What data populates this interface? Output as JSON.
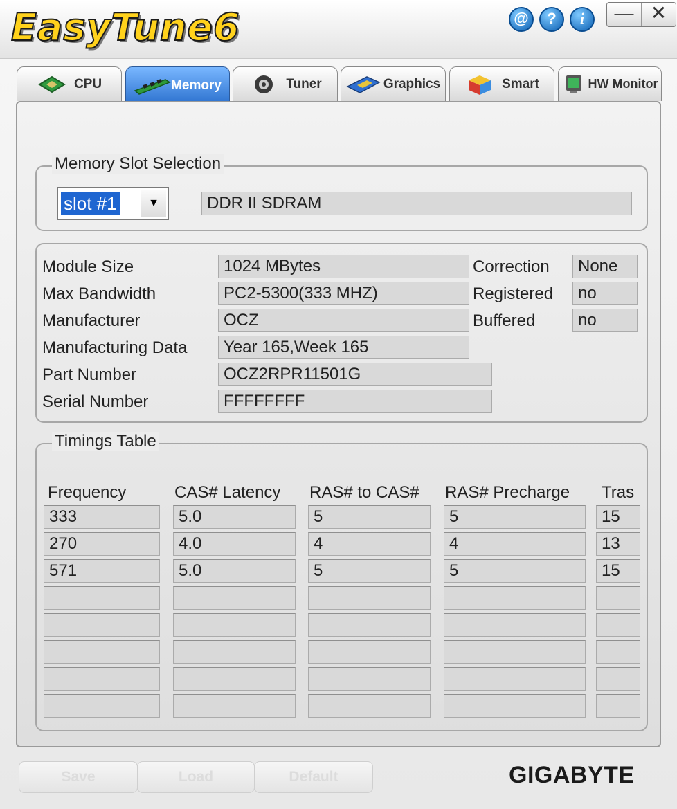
{
  "app": {
    "logo_text": "EasyTune6"
  },
  "header_icons": [
    {
      "icon": "at-icon",
      "glyph": "@"
    },
    {
      "icon": "help-icon",
      "glyph": "?"
    },
    {
      "icon": "info-icon",
      "glyph": "i"
    }
  ],
  "window_buttons": {
    "minimize": "—",
    "close": "✕"
  },
  "tabs": [
    {
      "label": "CPU",
      "icon": "cpu-chip-icon"
    },
    {
      "label": "Memory",
      "icon": "memory-stick-icon"
    },
    {
      "label": "Tuner",
      "icon": "tuner-dial-icon"
    },
    {
      "label": "Graphics",
      "icon": "graphics-card-icon"
    },
    {
      "label": "Smart",
      "icon": "smart-cube-icon"
    },
    {
      "label": "HW Monitor",
      "icon": "hw-monitor-icon"
    }
  ],
  "active_tab": "Memory",
  "slot_selection": {
    "legend": "Memory Slot Selection",
    "selected": "slot #1",
    "memory_type": "DDR II SDRAM"
  },
  "module_info": {
    "labels": {
      "module_size": "Module Size",
      "max_bandwidth": "Max Bandwidth",
      "manufacturer": "Manufacturer",
      "manufacturing_data": "Manufacturing Data",
      "part_number": "Part Number",
      "serial_number": "Serial Number",
      "correction": "Correction",
      "registered": "Registered",
      "buffered": "Buffered"
    },
    "values": {
      "module_size": "1024 MBytes",
      "max_bandwidth": "PC2-5300(333 MHZ)",
      "manufacturer": "OCZ",
      "manufacturing_data": "Year 165,Week 165",
      "part_number": "OCZ2RPR11501G",
      "serial_number": "FFFFFFFF",
      "correction": "None",
      "registered": "no",
      "buffered": "no"
    }
  },
  "timings": {
    "legend": "Timings Table",
    "headers": [
      "Frequency",
      "CAS# Latency",
      "RAS# to CAS#",
      "RAS# Precharge",
      "Tras"
    ],
    "rows": [
      [
        "333",
        "5.0",
        "5",
        "5",
        "15"
      ],
      [
        "270",
        "4.0",
        "4",
        "4",
        "13"
      ],
      [
        "571",
        "5.0",
        "5",
        "5",
        "15"
      ],
      [
        "",
        "",
        "",
        "",
        ""
      ],
      [
        "",
        "",
        "",
        "",
        ""
      ],
      [
        "",
        "",
        "",
        "",
        ""
      ],
      [
        "",
        "",
        "",
        "",
        ""
      ],
      [
        "",
        "",
        "",
        "",
        ""
      ]
    ]
  },
  "buttons": {
    "save": "Save",
    "load": "Load",
    "default": "Default"
  },
  "brand": "GIGABYTE",
  "colors": {
    "active_tab": "#3b82e0",
    "selection": "#1f66d1",
    "logo": "#ffd21c"
  }
}
